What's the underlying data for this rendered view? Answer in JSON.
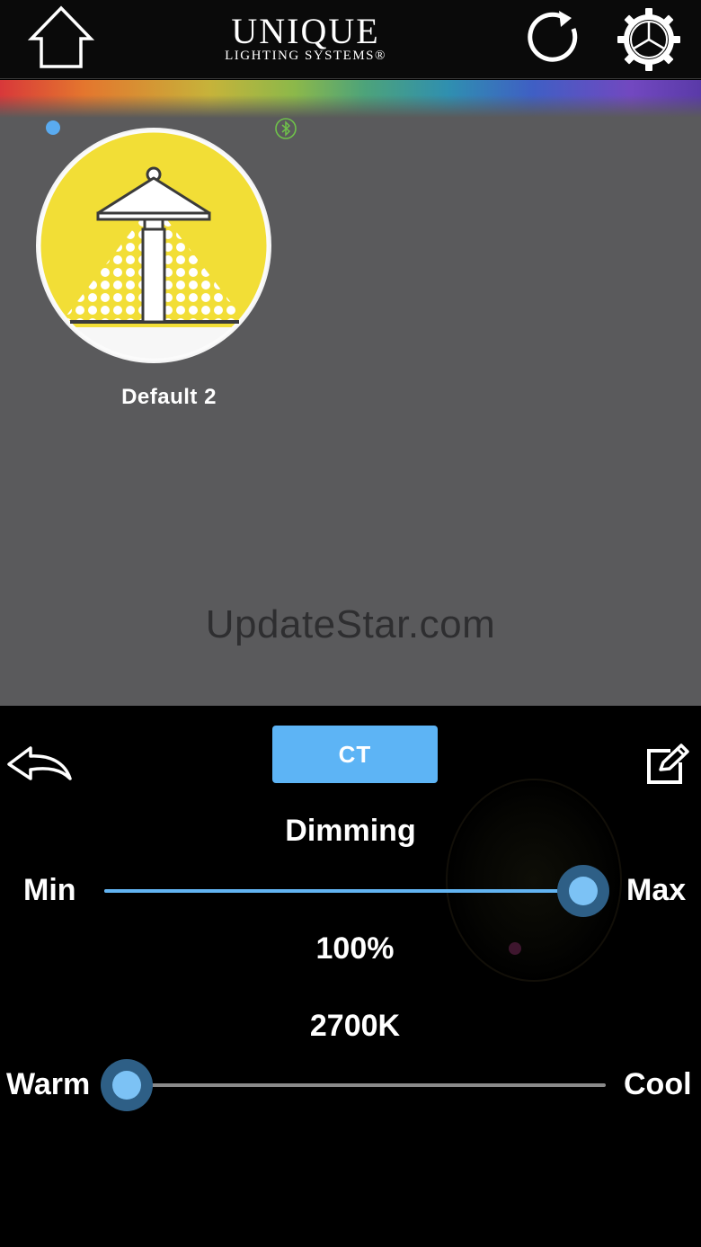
{
  "header": {
    "brand_name": "UNIQUE",
    "brand_sub": "LIGHTING SYSTEMS®",
    "icons": [
      "home-icon",
      "refresh-icon",
      "gear-icon"
    ]
  },
  "fixture": {
    "label": "Default 2",
    "icon": "path-light-icon",
    "status_dot_color": "#5aabf0",
    "fill_color": "#f2de36"
  },
  "watermark": "UpdateStar.com",
  "controls": {
    "mode_button": "CT",
    "mode_color": "#5db4f5",
    "dimming": {
      "title": "Dimming",
      "min_label": "Min",
      "max_label": "Max",
      "value_label": "100%",
      "value": 1.0
    },
    "color_temp": {
      "value_label": "2700K",
      "warm_label": "Warm",
      "cool_label": "Cool",
      "value": 0.0
    }
  }
}
